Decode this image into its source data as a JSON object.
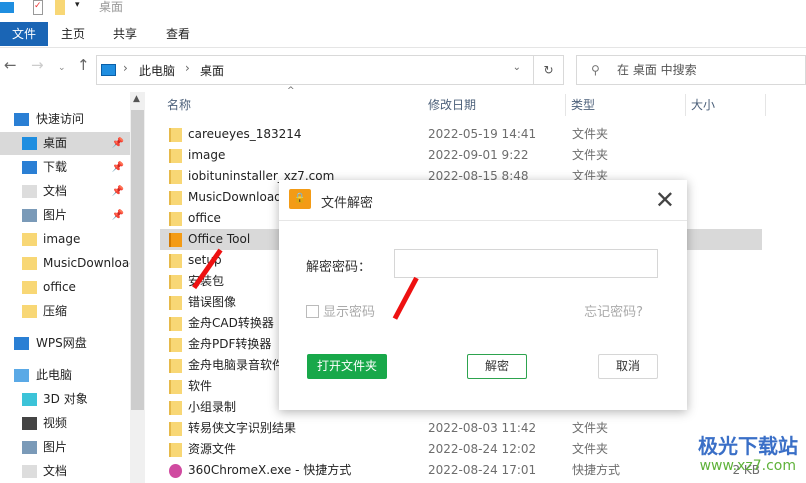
{
  "window": {
    "title": "桌面"
  },
  "ribbon": {
    "tabs": [
      "文件",
      "主页",
      "共享",
      "查看"
    ]
  },
  "address": {
    "crumbs": [
      "此电脑",
      "桌面"
    ],
    "search_placeholder": "在 桌面 中搜索"
  },
  "sidebar": {
    "items": [
      {
        "label": "快速访问",
        "icon": "star-icon",
        "hdr": true
      },
      {
        "label": "桌面",
        "icon": "desktop-icon",
        "pin": true,
        "sel": true
      },
      {
        "label": "下载",
        "icon": "download-icon",
        "pin": true
      },
      {
        "label": "文档",
        "icon": "document-icon",
        "pin": true
      },
      {
        "label": "图片",
        "icon": "picture-icon",
        "pin": true
      },
      {
        "label": "image",
        "icon": "folder-icon"
      },
      {
        "label": "MusicDownload",
        "icon": "folder-icon"
      },
      {
        "label": "office",
        "icon": "folder-icon"
      },
      {
        "label": "压缩",
        "icon": "folder-icon"
      },
      {
        "label": "WPS网盘",
        "icon": "cloud-icon",
        "hdr": true
      },
      {
        "label": "此电脑",
        "icon": "computer-icon",
        "hdr": true
      },
      {
        "label": "3D 对象",
        "icon": "cube-icon"
      },
      {
        "label": "视频",
        "icon": "video-icon"
      },
      {
        "label": "图片",
        "icon": "picture-icon"
      },
      {
        "label": "文档",
        "icon": "document-icon"
      }
    ]
  },
  "columns": {
    "name": "名称",
    "date": "修改日期",
    "type": "类型",
    "size": "大小"
  },
  "files": [
    {
      "name": "careueyes_183214",
      "date": "2022-05-19 14:41",
      "type": "文件夹",
      "size": ""
    },
    {
      "name": "image",
      "date": "2022-09-01 9:22",
      "type": "文件夹",
      "size": ""
    },
    {
      "name": "iobituninstaller_xz7.com",
      "date": "2022-08-15 8:48",
      "type": "文件夹",
      "size": ""
    },
    {
      "name": "MusicDownload",
      "date": "",
      "type": "",
      "size": ""
    },
    {
      "name": "office",
      "date": "",
      "type": "",
      "size": ""
    },
    {
      "name": "Office Tool",
      "date": "",
      "type": "",
      "size": ""
    },
    {
      "name": "setup",
      "date": "",
      "type": "",
      "size": ""
    },
    {
      "name": "安装包",
      "date": "",
      "type": "",
      "size": ""
    },
    {
      "name": "错误图像",
      "date": "",
      "type": "",
      "size": ""
    },
    {
      "name": "金舟CAD转换器",
      "date": "",
      "type": "",
      "size": ""
    },
    {
      "name": "金舟PDF转换器",
      "date": "",
      "type": "",
      "size": ""
    },
    {
      "name": "金舟电脑录音软件",
      "date": "",
      "type": "",
      "size": ""
    },
    {
      "name": "软件",
      "date": "",
      "type": "",
      "size": ""
    },
    {
      "name": "小组录制",
      "date": "",
      "type": "",
      "size": ""
    },
    {
      "name": "转易侠文字识别结果",
      "date": "2022-08-03 11:42",
      "type": "文件夹",
      "size": ""
    },
    {
      "name": "资源文件",
      "date": "2022-08-24 12:02",
      "type": "文件夹",
      "size": ""
    },
    {
      "name": "360ChromeX.exe - 快捷方式",
      "date": "2022-08-24 17:01",
      "type": "快捷方式",
      "size": "2 KB"
    }
  ],
  "dialog": {
    "title": "文件解密",
    "password_label": "解密密码：",
    "password_value": "",
    "show_password": "显示密码",
    "forgot": "忘记密码?",
    "open_folder": "打开文件夹",
    "decrypt": "解密",
    "cancel": "取消"
  },
  "watermark": {
    "brand": "极光下载站",
    "url": "www.xz7.com"
  },
  "colors": {
    "accent": "#1a65b5",
    "green": "#18a84a"
  }
}
